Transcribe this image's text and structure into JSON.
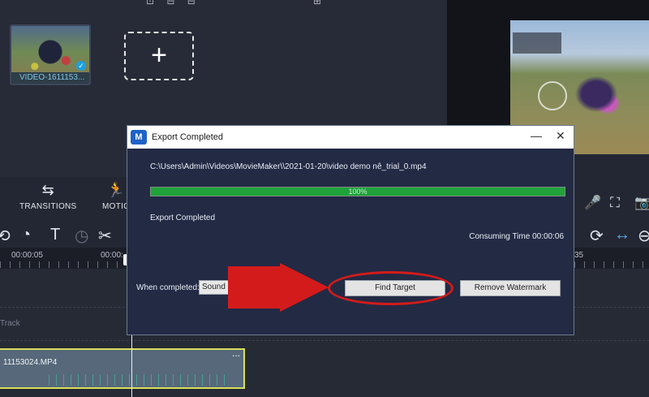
{
  "media": {
    "clip_thumb_label": "VIDEO-1611153...",
    "add_symbol": "+"
  },
  "toolbar": {
    "transitions_label": "TRANSITIONS",
    "motion_label": "MOTIO"
  },
  "timeline": {
    "time_left": "00:00:05",
    "time_mid": "00:00:",
    "time_right": "35",
    "track_label": "Track",
    "clip_name": "11153024.MP4",
    "clip_menu": "..."
  },
  "dialog": {
    "title": "Export Completed",
    "logo_letter": "M",
    "minimize": "—",
    "close": "✕",
    "file_path": "C:\\Users\\Admin\\Videos\\MovieMaker\\\\2021-01-20\\video demo nê_trial_0.mp4",
    "progress_text": "100%",
    "progress_fraction": 1.0,
    "status": "Export Completed",
    "consuming_time": "Consuming Time    00:00:06",
    "when_completed_label": "When completed:",
    "when_completed_value": "Sound re",
    "find_target_label": "Find Target",
    "remove_watermark_label": "Remove Watermark"
  },
  "colors": {
    "progress": "#1fa23a",
    "annotation": "#d41b1b",
    "clip_border": "#d7e05a"
  }
}
